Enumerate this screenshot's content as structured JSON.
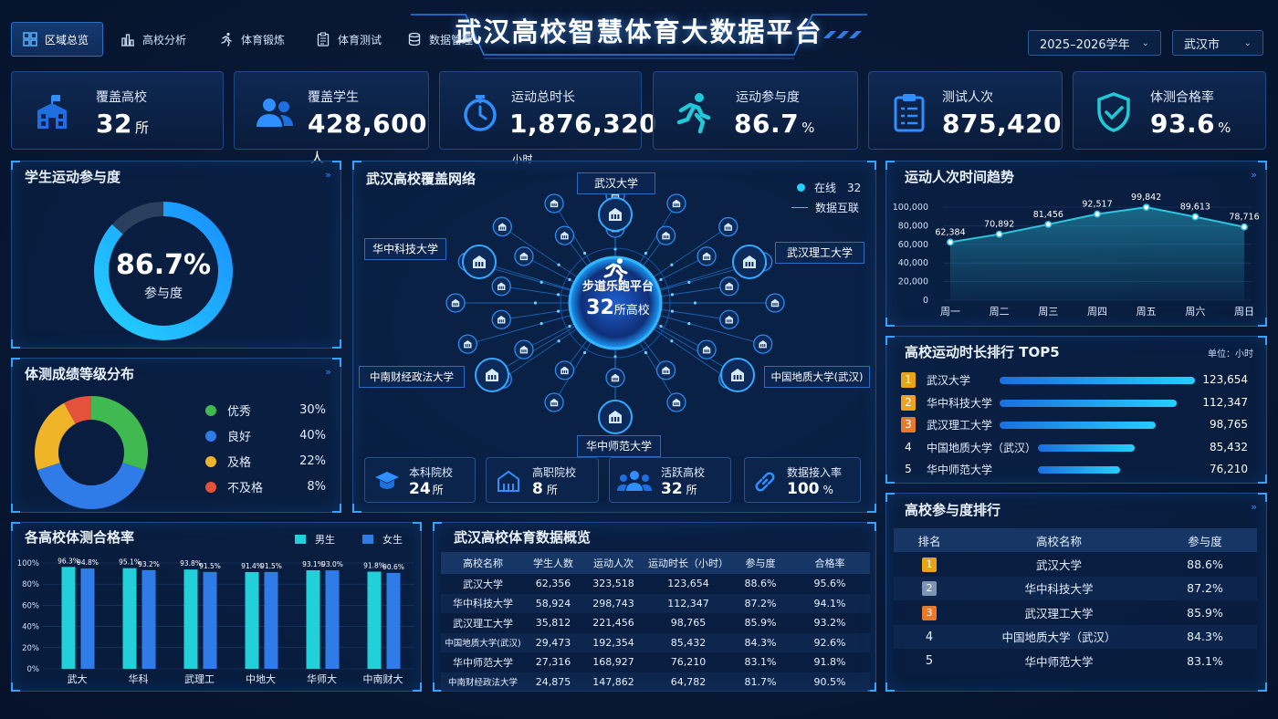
{
  "header": {
    "title": "武汉高校智慧体育大数据平台",
    "nav": [
      {
        "label": "区域总览",
        "icon": "grid-icon",
        "active": true
      },
      {
        "label": "高校分析",
        "icon": "building-chart-icon"
      },
      {
        "label": "体育锻炼",
        "icon": "runner-icon"
      },
      {
        "label": "体育测试",
        "icon": "clipboard-icon"
      },
      {
        "label": "数据管理",
        "icon": "database-icon"
      }
    ],
    "year_select": "2025–2026学年",
    "city_select": "武汉市"
  },
  "kpis": [
    {
      "label": "覆盖高校",
      "value": "32",
      "unit": "所",
      "icon": "school-icon"
    },
    {
      "label": "覆盖学生",
      "value": "428,600",
      "unit": "人",
      "icon": "users-icon"
    },
    {
      "label": "运动总时长",
      "value": "1,876,320",
      "unit": "小时",
      "icon": "stopwatch-icon"
    },
    {
      "label": "运动参与度",
      "value": "86.7",
      "unit": "%",
      "icon": "runner-icon"
    },
    {
      "label": "测试人次",
      "value": "875,420",
      "unit": "",
      "icon": "clipboard-icon"
    },
    {
      "label": "体测合格率",
      "value": "93.6",
      "unit": "%",
      "icon": "shield-check-icon"
    }
  ],
  "participation": {
    "title": "学生运动参与度",
    "value_text": "86.7%",
    "value": 86.7,
    "caption": "参与度",
    "mark": "»"
  },
  "grade_dist": {
    "title": "体测成绩等级分布",
    "mark": "»",
    "items": [
      {
        "label": "优秀",
        "value": 30,
        "pct": "30%",
        "color": "#3fb950"
      },
      {
        "label": "良好",
        "value": 40,
        "pct": "40%",
        "color": "#2f7be8"
      },
      {
        "label": "及格",
        "value": 22,
        "pct": "22%",
        "color": "#f0b429"
      },
      {
        "label": "不及格",
        "value": 8,
        "pct": "8%",
        "color": "#e4523b"
      }
    ]
  },
  "network": {
    "title": "武汉高校覆盖网络",
    "legend_online": "在线",
    "legend_online_count": "32",
    "legend_link": "数据互联",
    "center_name": "步道乐跑平台",
    "center_count": "32",
    "center_unit": "所高校",
    "named_nodes": [
      "武汉大学",
      "武汉理工大学",
      "中国地质大学(武汉)",
      "华中师范大学",
      "中南财经政法大学",
      "华中科技大学"
    ],
    "stats": [
      {
        "label": "本科院校",
        "value": "24",
        "unit": "所",
        "icon": "graduation-cap-icon"
      },
      {
        "label": "高职院校",
        "value": "8",
        "unit": "所",
        "icon": "school-icon"
      },
      {
        "label": "活跃高校",
        "value": "32",
        "unit": "所",
        "icon": "users-icon"
      },
      {
        "label": "数据接入率",
        "value": "100",
        "unit": "%",
        "icon": "link-icon"
      }
    ]
  },
  "trend": {
    "title": "运动人次时间趋势",
    "mark": "»",
    "yticks": [
      "100,000",
      "80,000",
      "60,000",
      "40,000",
      "20,000",
      "0"
    ]
  },
  "top5": {
    "title": "高校运动时长排行 TOP5",
    "unit_note": "单位：小时",
    "rows": [
      {
        "rank": "1",
        "name": "武汉大学",
        "value_text": "123,654",
        "value": 123654,
        "badge": "#e8a317"
      },
      {
        "rank": "2",
        "name": "华中科技大学",
        "value_text": "112,347",
        "value": 112347,
        "badge": "#f0a21b"
      },
      {
        "rank": "3",
        "name": "武汉理工大学",
        "value_text": "98,765",
        "value": 98765,
        "badge": "#e8792a"
      },
      {
        "rank": "4",
        "name": "中国地质大学（武汉）",
        "value_text": "85,432",
        "value": 85432,
        "badge": ""
      },
      {
        "rank": "5",
        "name": "华中师范大学",
        "value_text": "76,210",
        "value": 76210,
        "badge": ""
      }
    ]
  },
  "pass_rate": {
    "title": "各高校体测合格率",
    "legend_male": "男生",
    "legend_female": "女生",
    "yticks": [
      "100%",
      "80%",
      "60%",
      "40%",
      "20%",
      "0%"
    ]
  },
  "overview": {
    "title": "武汉高校体育数据概览",
    "headers": [
      "高校名称",
      "学生人数",
      "运动人次",
      "运动时长（小时）",
      "参与度",
      "合格率"
    ],
    "rows": [
      [
        "武汉大学",
        "62,356",
        "323,518",
        "123,654",
        "88.6%",
        "95.6%"
      ],
      [
        "华中科技大学",
        "58,924",
        "298,743",
        "112,347",
        "87.2%",
        "94.1%"
      ],
      [
        "武汉理工大学",
        "35,812",
        "221,456",
        "98,765",
        "85.9%",
        "93.2%"
      ],
      [
        "中国地质大学(武汉)",
        "29,473",
        "192,354",
        "85,432",
        "84.3%",
        "92.6%"
      ],
      [
        "华中师范大学",
        "27,316",
        "168,927",
        "76,210",
        "83.1%",
        "91.8%"
      ],
      [
        "中南财经政法大学",
        "24,875",
        "147,862",
        "64,782",
        "81.7%",
        "90.5%"
      ]
    ]
  },
  "participation_rank": {
    "title": "高校参与度排行",
    "mark": "»",
    "headers": [
      "排名",
      "高校名称",
      "参与度"
    ],
    "rows": [
      {
        "rank": "1",
        "name": "武汉大学",
        "value": "88.6%",
        "badge": "#e8a317"
      },
      {
        "rank": "2",
        "name": "华中科技大学",
        "value": "87.2%",
        "badge": "#7f93b5"
      },
      {
        "rank": "3",
        "name": "武汉理工大学",
        "value": "85.9%",
        "badge": "#e8792a"
      },
      {
        "rank": "4",
        "name": "中国地质大学（武汉）",
        "value": "84.3%",
        "badge": ""
      },
      {
        "rank": "5",
        "name": "华中师范大学",
        "value": "83.1%",
        "badge": ""
      }
    ]
  },
  "chart_data": [
    {
      "type": "area",
      "title": "运动人次时间趋势",
      "categories": [
        "周一",
        "周二",
        "周三",
        "周四",
        "周五",
        "周六",
        "周日"
      ],
      "values": [
        62384,
        70892,
        81456,
        92517,
        99842,
        89613,
        78716
      ],
      "labels": [
        "62,384",
        "70,892",
        "81,456",
        "92,517",
        "99,842",
        "89,613",
        "78,716"
      ],
      "ylim": [
        0,
        100000
      ],
      "color": "#2ec3e0"
    },
    {
      "type": "bar",
      "title": "各高校体测合格率",
      "categories": [
        "武大",
        "华科",
        "武理工",
        "中地大",
        "华师大",
        "中南财大"
      ],
      "series": [
        {
          "name": "男生",
          "values": [
            96.3,
            95.1,
            93.8,
            91.4,
            93.1,
            91.8
          ],
          "labels": [
            "96.3%",
            "95.1%",
            "93.8%",
            "91.4%",
            "93.1%",
            "91.8%"
          ],
          "color": "#21d0d8"
        },
        {
          "name": "女生",
          "values": [
            94.8,
            93.2,
            91.5,
            91.5,
            93.0,
            90.6
          ],
          "labels": [
            "94.8%",
            "93.2%",
            "91.5%",
            "91.5%",
            "93.0%",
            "90.6%"
          ],
          "color": "#2f7be8"
        }
      ],
      "ylim": [
        0,
        100
      ]
    }
  ]
}
